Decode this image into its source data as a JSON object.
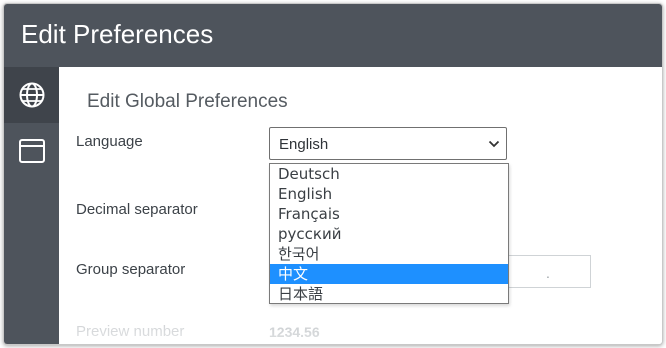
{
  "window": {
    "title": "Edit Preferences"
  },
  "sidebar": {
    "items": [
      {
        "icon": "globe-icon",
        "active": true
      },
      {
        "icon": "window-icon",
        "active": false
      }
    ]
  },
  "main": {
    "section_title": "Edit Global Preferences",
    "language": {
      "label": "Language",
      "selected": "English"
    },
    "decimal_separator": {
      "label": "Decimal separator"
    },
    "group_separator": {
      "label": "Group separator",
      "value": "."
    },
    "preview": {
      "label": "Preview number",
      "value": "1234.56"
    }
  },
  "dropdown": {
    "options": [
      "Deutsch",
      "English",
      "Français",
      "русский",
      "한국어",
      "中文",
      "日本語"
    ],
    "highlighted_index": 5
  },
  "colors": {
    "header_bg": "#4e545c",
    "highlight": "#1e90ff"
  }
}
